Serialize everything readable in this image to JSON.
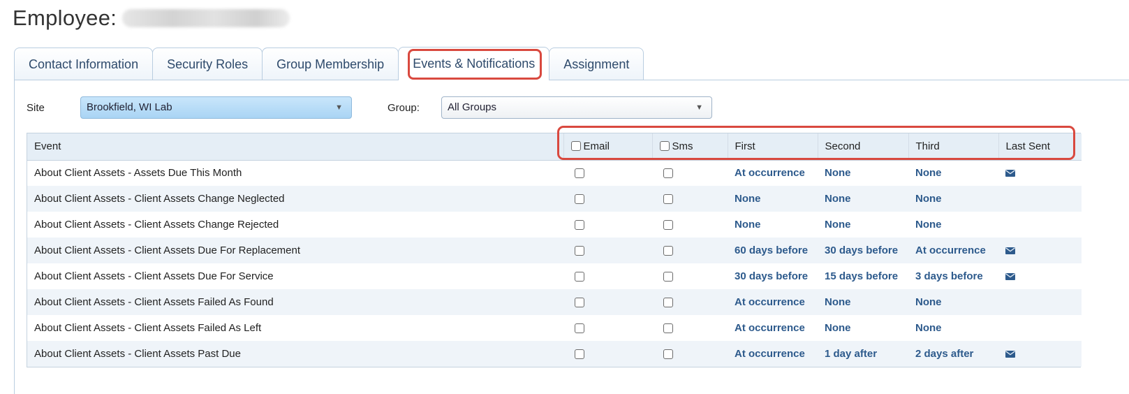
{
  "page": {
    "title_prefix": "Employee:"
  },
  "tabs": [
    {
      "label": "Contact Information"
    },
    {
      "label": "Security Roles"
    },
    {
      "label": "Group Membership"
    },
    {
      "label": "Events & Notifications",
      "active": true
    },
    {
      "label": "Assignment"
    }
  ],
  "filters": {
    "site_label": "Site",
    "site_value": "Brookfield, WI Lab",
    "group_label": "Group:",
    "group_value": "All Groups"
  },
  "table": {
    "headers": {
      "event": "Event",
      "email": "Email",
      "sms": "Sms",
      "first": "First",
      "second": "Second",
      "third": "Third",
      "last_sent": "Last Sent"
    },
    "rows": [
      {
        "event": "About Client Assets - Assets Due This Month",
        "email_checked": false,
        "sms_checked": false,
        "first": "At occurrence",
        "second": "None",
        "third": "None",
        "last_sent_icon": "envelope-icon"
      },
      {
        "event": "About Client Assets - Client Assets Change Neglected",
        "email_checked": false,
        "sms_checked": false,
        "first": "None",
        "second": "None",
        "third": "None",
        "last_sent_icon": ""
      },
      {
        "event": "About Client Assets - Client Assets Change Rejected",
        "email_checked": false,
        "sms_checked": false,
        "first": "None",
        "second": "None",
        "third": "None",
        "last_sent_icon": ""
      },
      {
        "event": "About Client Assets - Client Assets Due For Replacement",
        "email_checked": false,
        "sms_checked": false,
        "first": "60 days before",
        "second": "30 days before",
        "third": "At occurrence",
        "last_sent_icon": "envelope-icon"
      },
      {
        "event": "About Client Assets - Client Assets Due For Service",
        "email_checked": false,
        "sms_checked": false,
        "first": "30 days before",
        "second": "15 days before",
        "third": "3 days before",
        "last_sent_icon": "envelope-icon"
      },
      {
        "event": "About Client Assets - Client Assets Failed As Found",
        "email_checked": false,
        "sms_checked": false,
        "first": "At occurrence",
        "second": "None",
        "third": "None",
        "last_sent_icon": ""
      },
      {
        "event": "About Client Assets - Client Assets Failed As Left",
        "email_checked": false,
        "sms_checked": false,
        "first": "At occurrence",
        "second": "None",
        "third": "None",
        "last_sent_icon": ""
      },
      {
        "event": "About Client Assets - Client Assets Past Due",
        "email_checked": false,
        "sms_checked": false,
        "first": "At occurrence",
        "second": "1 day after",
        "third": "2 days after",
        "last_sent_icon": "envelope-icon"
      }
    ]
  },
  "colors": {
    "accent": "#2d5a8c",
    "highlight": "#d9493f",
    "header_bg": "#e5eef6",
    "row_alt_bg": "#eff4f9"
  }
}
